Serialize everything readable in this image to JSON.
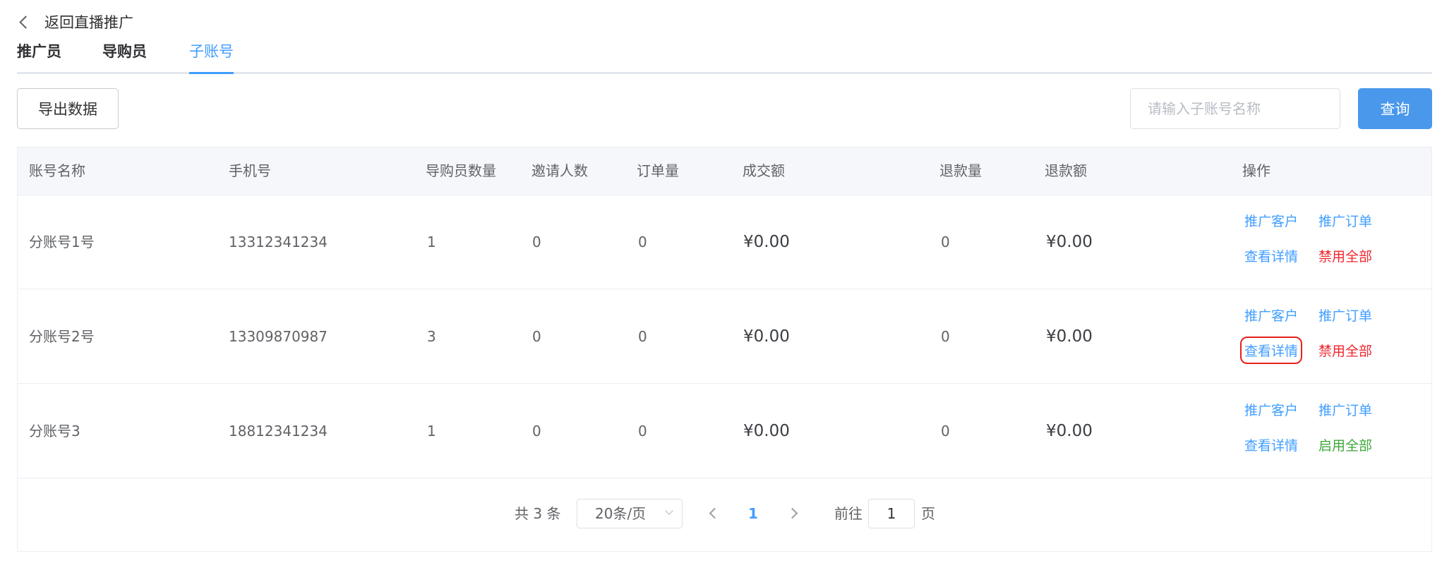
{
  "back_label": "返回直播推广",
  "tabs": [
    {
      "label": "推广员",
      "active": false
    },
    {
      "label": "导购员",
      "active": false
    },
    {
      "label": "子账号",
      "active": true
    }
  ],
  "toolbar": {
    "export_label": "导出数据",
    "search_placeholder": "请输入子账号名称",
    "search_value": "",
    "query_label": "查询"
  },
  "table": {
    "columns": [
      "账号名称",
      "手机号",
      "导购员数量",
      "邀请人数",
      "订单量",
      "成交额",
      "退款量",
      "退款额",
      "操作"
    ],
    "rows": [
      {
        "name": "分账号1号",
        "phone": "13312341234",
        "guides": "1",
        "invites": "0",
        "orders": "0",
        "amount": "¥0.00",
        "refunds": "0",
        "refund_amount": "¥0.00",
        "actions": {
          "customers": "推广客户",
          "orders": "推广订单",
          "details": "查看详情",
          "toggle": "禁用全部",
          "toggle_state": "disable"
        }
      },
      {
        "name": "分账号2号",
        "phone": "13309870987",
        "guides": "3",
        "invites": "0",
        "orders": "0",
        "amount": "¥0.00",
        "refunds": "0",
        "refund_amount": "¥0.00",
        "actions": {
          "customers": "推广客户",
          "orders": "推广订单",
          "details": "查看详情",
          "toggle": "禁用全部",
          "toggle_state": "disable"
        }
      },
      {
        "name": "分账号3",
        "phone": "18812341234",
        "guides": "1",
        "invites": "0",
        "orders": "0",
        "amount": "¥0.00",
        "refunds": "0",
        "refund_amount": "¥0.00",
        "actions": {
          "customers": "推广客户",
          "orders": "推广订单",
          "details": "查看详情",
          "toggle": "启用全部",
          "toggle_state": "enable"
        }
      }
    ]
  },
  "pagination": {
    "total_label": "共 3 条",
    "page_size_label": "20条/页",
    "current_page": "1",
    "goto_label": "前往",
    "goto_value": "1",
    "page_suffix": "页"
  },
  "colors": {
    "accent": "#409eff",
    "primary_button": "#4a98ec",
    "danger": "#f0272f",
    "success": "#3fa83b",
    "highlight_box": "#e8211a"
  }
}
